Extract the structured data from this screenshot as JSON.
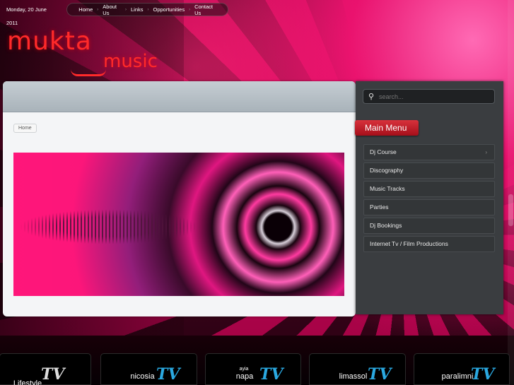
{
  "topbar": {
    "date": "Monday, 20 June 2011",
    "nav": [
      "Home",
      "About Us",
      "Links",
      "Opportunities",
      "Contact Us"
    ]
  },
  "logo": {
    "line1": "mukta",
    "line2": "music"
  },
  "main": {
    "breadcrumb": "Home"
  },
  "sidebar": {
    "search_placeholder": "search...",
    "menu_title": "Main Menu",
    "menu": [
      {
        "label": "Dj Course",
        "has_submenu": true
      },
      {
        "label": "Discography"
      },
      {
        "label": "Music Tracks"
      },
      {
        "label": "Parties"
      },
      {
        "label": "Dj Bookings"
      },
      {
        "label": "Internet Tv / Film Productions"
      }
    ]
  },
  "channels": [
    {
      "name": "Lifestyle",
      "tv": "TV"
    },
    {
      "name": "nicosia",
      "tv": "TV"
    },
    {
      "name": "napa",
      "sub": "ayia",
      "tv": "TV"
    },
    {
      "name": "limassol",
      "tv": "TV"
    },
    {
      "name": "paralimni",
      "tv": "TV"
    }
  ],
  "colors": {
    "accent": "#d8323c",
    "brand": "#ff2a2a",
    "tv": "#2aa8e0"
  }
}
